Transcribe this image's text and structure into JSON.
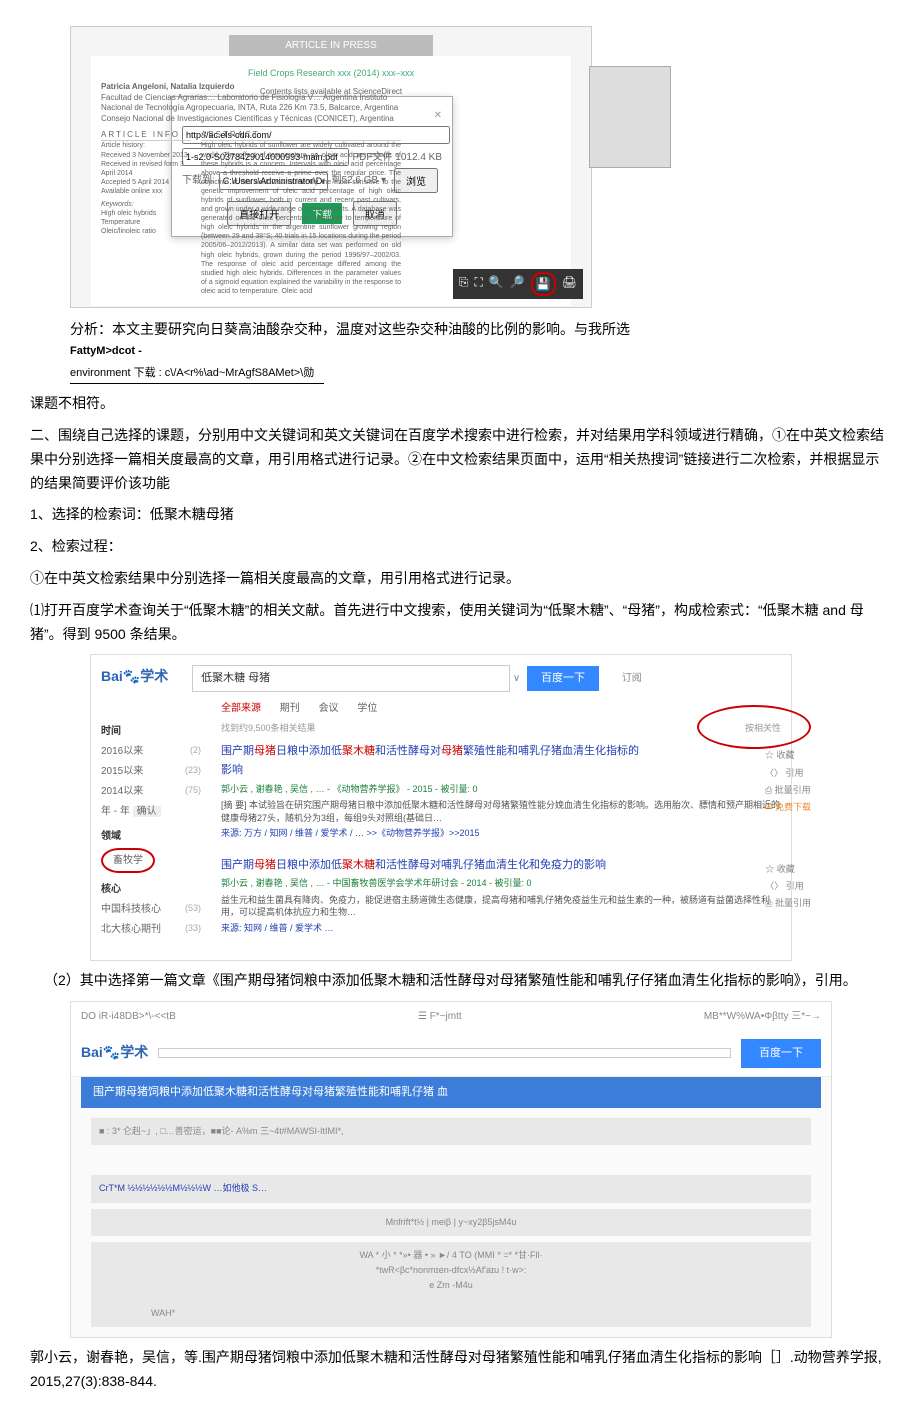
{
  "pdf": {
    "header": "ARTICLE IN PRESS",
    "journal_line": "Field Crops Research xxx (2014) xxx–xxx",
    "contents_line": "Contents lists available at ScienceDirect",
    "modal": {
      "url": "http://ac.els-cdn.com/",
      "filename": "1-s2.0-S0378429014000993-main.pdf",
      "size_label": "PDF文件 1012.4 KB",
      "path_label": "下载到:",
      "path": "C:\\Users\\Administrator\\Desktop\\…",
      "remain": "剩52.6 GB ▾",
      "browse": "浏览",
      "btn_open": "直接打开",
      "btn_download": "下载",
      "btn_cancel": "取消"
    },
    "authors": "Patricia Angeloni, Natalia Izquierdo",
    "affil": "Facultad de Ciencias Agrarias… Laboratorio de Fisiología V… Argentina\nInstituto Nacional de Tecnología Agropecuaria, INTA, Ruta 226 Km 73.5, Balcarce, Argentina\nConsejo Nacional de Investigaciones Científicas y Técnicas (CONICET), Argentina",
    "info": "ARTICLE INFO",
    "history": "Article history:\nReceived 3 November 2013\nReceived in revised form 3 April 2014\nAccepted 5 April 2014\nAvailable online xxx",
    "kw_head": "Keywords:",
    "kw": "High oleic hybrids\nTemperature\nOleic/linoleic ratio",
    "abs_head": "ABSTRACT",
    "abstract": "High oleic hybrids of sunflower are widely cultivated around the world. The effect of temperature on oleic acid percentage of these hybrids is a concern. Intervals with oleic acid percentage above a threshold receive a prime over the regular price. The objective of this work was to identify the most sensitive to the genetic improvement of oleic acid percentage of high oleic hybrids of sunflower, both in current and recent past cultivars, and grown under a wide range of environments. A database was generated on the oleic percentage response to temperature of high oleic hybrids in the argentine sunflower growing region (between 29 and 38°S; 40 trials in 15 locations during the period 2005/06–2012/2013). A similar data set was performed on old high oleic hybrids, grown during the period 1996/97–2002/03. The response of oleic acid percentage differed among the studied high oleic hybrids. Differences in the parameter values of a sigmoid equation explained the variability in the response to oleic acid to temperature. Oleic acid",
    "toolbar": [
      "⎘",
      "⛶",
      "🔍",
      "🔎",
      "💾",
      "🖨"
    ]
  },
  "analysis1": "分析：本文主要研究向日葵高油酸杂交种，温度对这些杂交种油酸的比例的影响。与我所选",
  "path_str": {
    "top": "FattyM>dcot -",
    "line": "environment 下载 : c\\/A<r%\\ad~MrAgfS8AMet>\\勋"
  },
  "line_after_path": "课题不相符。",
  "section2_intro": "二、围绕自己选择的课题，分别用中文关键词和英文关键词在百度学术搜索中进行检索，并对结果用学科领域进行精确，①在中英文检索结果中分别选择一篇相关度最高的文章，用引用格式进行记录。②在中文检索结果页面中，运用“相关热搜词”链接进行二次检索，并根据显示的结果简要评价该功能",
  "line_1": "1、选择的检索词：低聚木糖母猪",
  "line_2": "2、检索过程：",
  "line_step1": "①在中英文检索结果中分别选择一篇相关度最高的文章，用引用格式进行记录。",
  "line_open": "⑴打开百度学术查询关于“低聚木糖”的相关文献。首先进行中文搜索，使用关键词为“低聚木糖”、“母猪”，构成检索式：“低聚木糖 and 母猪”。得到 9500 条结果。",
  "baidu1": {
    "logo": "Bai",
    "logo2": "学术",
    "query": "低聚木糖 母猪",
    "btn": "百度一下",
    "subscribe": "订阅",
    "tabs": {
      "all": "全部来源",
      "journal": "期刊",
      "diss": "会议",
      "xue": "学位"
    },
    "total": "找到约9,500条相关结果",
    "hot": "按相关性",
    "left": {
      "time": "时间",
      "y1": "2016以来",
      "c1": "(2)",
      "y2": "2015以来",
      "c2": "(23)",
      "y3": "2014以来",
      "c3": "(75)",
      "yr": "年 - 年",
      "confirm": "确认",
      "field": "领域",
      "xmy": "畜牧学",
      "core": "核心",
      "k1": "中国科技核心",
      "kc1": "(53)",
      "k2": "北大核心期刊",
      "kc2": "(33)"
    },
    "r1": {
      "title_pre": "围产期",
      "kw1": "母猪",
      "mid1": "日粮中添加低",
      "kw2": "聚木糖",
      "mid2": "和活性酵母对",
      "kw3": "母猪",
      "mid3": "繁殖性能和哺乳仔猪血清生化指标的",
      "end": "影响",
      "meta": "郭小云 , 谢春艳 , 吴信 , … - 《动物营养学报》 - 2015 - 被引量: 0",
      "snip": "[摘 要] 本试验旨在研究围产期母猪日粮中添加低聚木糖和活性酵母对母猪繁殖性能分娩血清生化指标的影响。选用胎次、膘情和预产期相近的健康母猪27头，随机分为3组，每组9头对照组(基础日…",
      "links": "来源: 万方 / 知网 / 维普 / 爱学术 / … >>《动物营养学报》>>2015",
      "s1": "☆ 收藏",
      "s2": "〈〉 引用",
      "s3": "⎙ 批量引用",
      "s4": "✉ 免费下载"
    },
    "r2": {
      "title_pre": "围产期",
      "kw1": "母猪",
      "mid1": "日粮中添加低",
      "kw2": "聚木糖",
      "mid2": "和活性酵母对哺乳仔猪血清生化和免疫力的影响",
      "meta": "郭小云 , 谢春艳 , 吴信 , … - 中国畜牧兽医学会学术年研讨会 - 2014 - 被引量: 0",
      "snip": "益生元和益生菌具有降肉、免疫力，能促进宿主肠道微生态健康，提高母猪和哺乳仔猪免疫益生元和益生素的一种，被肠道有益菌选择性利用，可以提高机体抗应力和生物…",
      "links": "来源: 知网 / 维普 / 爱学术 …",
      "s1": "☆ 收藏",
      "s2": "〈〉 引用",
      "s3": "⎙ 批量引用"
    }
  },
  "line_select2": "（2）其中选择第一篇文章《围产期母猪饲粮中添加低聚木糖和活性酵母对母猪繁殖性能和哺乳仔仔猪血清生化指标的影响》，引用。",
  "cite_panel": {
    "left_code": "DO iR-i48DB>*\\-<<tB",
    "mid": "☰ F*~jmtt",
    "right": "MB**W%WA•Φβtty 三*~→",
    "logo": "Bai",
    "logo2": "学术",
    "btn": "百度一下",
    "title": "围产期母猪饲粮中添加低聚木糖和活性酵母对母猪繁殖性能和哺乳仔猪 血",
    "sub": "■ : 3* 仑赳~」, □…善密运，■■论- A%m 三~4t#MAWSI-ItIMI*,",
    "crtm": "CrT*M ½½½½½½M½½½W …如他极 S…",
    "strip1": "Mnfrift*t½ | meiβ | y~xy2β5jsM4u",
    "strip2": "WA * 小 * *»• 器 • »       ►/    4 TO (MMI * =* *甘·Fll·\n*twR<βc*nonmɪen-dfcx½Af'aɪu ! t·w>:\ne           Zm -M4u",
    "strip3": "WAH*"
  },
  "citation": "郭小云，谢春艳，吴信，等.围产期母猪饲粮中添加低聚木糖和活性酵母对母猪繁殖性能和哺乳仔猪血清生化指标的影响［］.动物营养学报, 2015,27(3):838-844."
}
